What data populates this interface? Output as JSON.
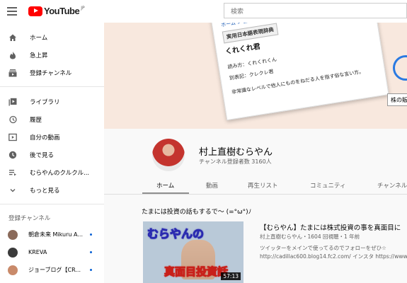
{
  "topbar": {
    "logo_text": "YouTube",
    "logo_region": "JP",
    "search_placeholder": "検索"
  },
  "sidebar": {
    "main": [
      {
        "icon": "home-icon",
        "label": "ホーム"
      },
      {
        "icon": "trending-icon",
        "label": "急上昇"
      },
      {
        "icon": "subscriptions-icon",
        "label": "登録チャンネル"
      }
    ],
    "library": [
      {
        "icon": "library-icon",
        "label": "ライブラリ"
      },
      {
        "icon": "history-icon",
        "label": "履歴"
      },
      {
        "icon": "your-videos-icon",
        "label": "自分の動画"
      },
      {
        "icon": "watch-later-icon",
        "label": "後で見る"
      },
      {
        "icon": "playlist-icon",
        "label": "むらやんのクルクル..."
      },
      {
        "icon": "chevron-down-icon",
        "label": "もっと見る"
      }
    ],
    "subscriptions_header": "登録チャンネル",
    "subscriptions": [
      {
        "label": "朝倉未来 Mikuru A...",
        "color": "#8a6a5a"
      },
      {
        "label": "KREVA",
        "color": "#3b3b3b"
      },
      {
        "label": "ジョーブログ【CR...",
        "color": "#c98a6a"
      }
    ]
  },
  "banner": {
    "paper_lines": [
      "ホーム > 日本語表現辞典 > くれくれ君",
      "実用日本語表現辞典",
      "くれくれ君",
      "読み方：くれくれくん",
      "別表記：クレクレ君",
      "非常識なレベルで他人にものをねだる人を指す俗な言い方。"
    ],
    "stock_label": "株の販"
  },
  "channel": {
    "name": "村上直樹むらやん",
    "subscribers": "チャンネル登録者数 3160人",
    "tabs": [
      "ホーム",
      "動画",
      "再生リスト",
      "コミュニティ",
      "チャンネル"
    ],
    "active_tab": 0
  },
  "shelf": {
    "title": "たまには投資の話もするで～ (=°ω°)ﾉ",
    "video": {
      "title": "【むらやん】たまには株式投資の事を真面目に",
      "meta": "村上直樹むらやん・1604 回視聴・1 年前",
      "desc_line1": "ツイッターをメインで使ってるのでフォローをぜひ☆",
      "desc_line2": "http://cadillac600.blog14.fc2.com/ インスタ https://www",
      "thumb_text_top": "むらやんの",
      "thumb_text_bottom": "真面目投資話",
      "duration": "57:13"
    }
  }
}
